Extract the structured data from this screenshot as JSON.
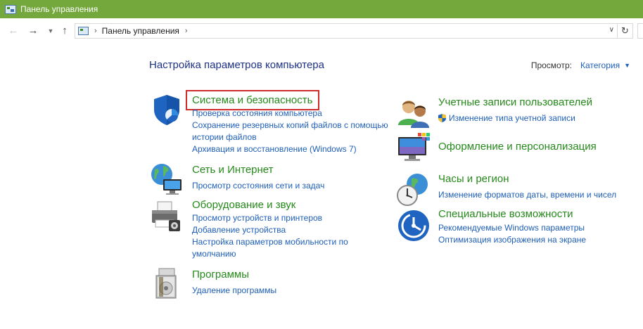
{
  "window": {
    "title": "Панель управления"
  },
  "nav": {
    "address_path": "Панель управления"
  },
  "header": {
    "title": "Настройка параметров компьютера",
    "view_label": "Просмотр:",
    "view_value": "Категория"
  },
  "left": [
    {
      "title": "Система и безопасность",
      "icon": "security-shield-icon",
      "links": [
        "Проверка состояния компьютера",
        "Сохранение резервных копий файлов с помощью",
        "истории файлов",
        "Архивация и восстановление (Windows 7)"
      ]
    },
    {
      "title": "Сеть и Интернет",
      "icon": "network-globe-icon",
      "links": [
        "Просмотр состояния сети и задач"
      ]
    },
    {
      "title": "Оборудование и звук",
      "icon": "printer-icon",
      "links": [
        "Просмотр устройств и принтеров",
        "Добавление устройства",
        "Настройка параметров мобильности по",
        "умолчанию"
      ]
    },
    {
      "title": "Программы",
      "icon": "programs-disc-icon",
      "links": [
        "Удаление программы"
      ]
    }
  ],
  "right": [
    {
      "title": "Учетные записи пользователей",
      "icon": "users-icon",
      "links": [
        "Изменение типа учетной записи"
      ]
    },
    {
      "title": "Оформление и персонализация",
      "icon": "monitor-palette-icon",
      "links": []
    },
    {
      "title": "Часы и регион",
      "icon": "clock-globe-icon",
      "links": [
        "Изменение форматов даты, времени и чисел"
      ]
    },
    {
      "title": "Специальные возможности",
      "icon": "accessibility-icon",
      "links": [
        "Рекомендуемые Windows параметры",
        "Оптимизация изображения на экране"
      ]
    }
  ],
  "colors": {
    "titlebar": "#74a83c",
    "category_title": "#26891b",
    "link": "#1f5fb8",
    "highlight_border": "#d02b2b"
  }
}
